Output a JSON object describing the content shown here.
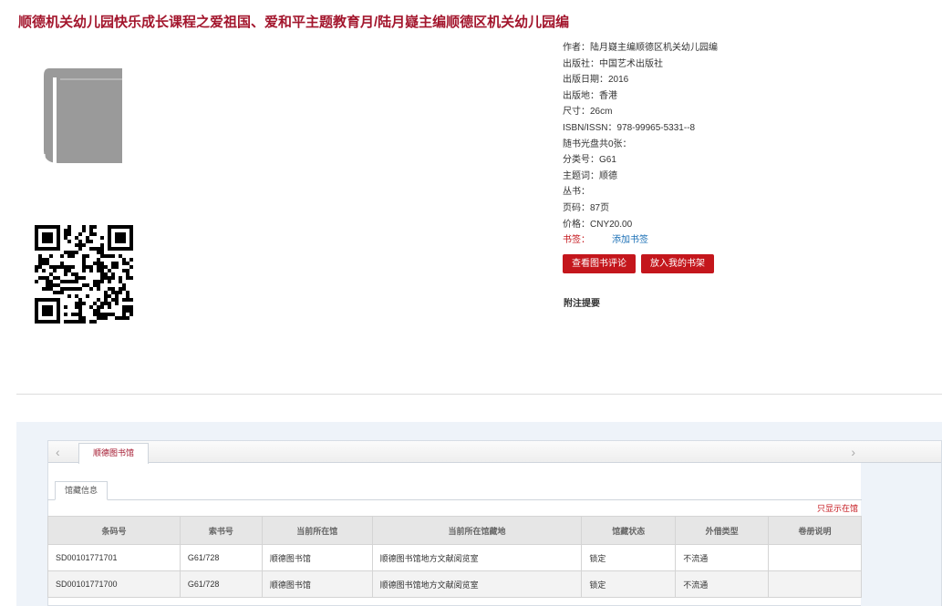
{
  "title": "顺德机关幼儿园快乐成长课程之爱祖国、爱和平主题教育月/陆月嶷主编顺德区机关幼儿园编",
  "book": {
    "meta": [
      {
        "label": "作者：",
        "value": "陆月嶷主编顺德区机关幼儿园编"
      },
      {
        "label": "出版社：",
        "value": "中国艺术出版社"
      },
      {
        "label": "出版日期：",
        "value": "2016"
      },
      {
        "label": "出版地：",
        "value": "香港"
      },
      {
        "label": "尺寸：",
        "value": "26cm"
      },
      {
        "label": "ISBN/ISSN：",
        "value": "978-99965-5331--8"
      },
      {
        "label": "随书光盘共0张：",
        "value": ""
      },
      {
        "label": "分类号：",
        "value": "G61"
      },
      {
        "label": "主题词：",
        "value": "顺德"
      },
      {
        "label": "丛书：",
        "value": ""
      },
      {
        "label": "页码：",
        "value": "87页"
      },
      {
        "label": "价格：",
        "value": "CNY20.00"
      }
    ],
    "bookmark_label": "书签：",
    "bookmark_link": "添加书签",
    "btn_review": "查看图书评论",
    "btn_shelf": "放入我的书架",
    "note_title": "附注提要"
  },
  "holdings": {
    "library_tab": "顺德图书馆",
    "sub_tab": "馆藏信息",
    "only_show": "只显示在馆",
    "columns": [
      "条码号",
      "索书号",
      "当前所在馆",
      "当前所在馆藏地",
      "馆藏状态",
      "外借类型",
      "卷册说明"
    ],
    "rows": [
      [
        "SD00101771701",
        "G61/728",
        "顺德图书馆",
        "顺德图书馆地方文献阅览室",
        "锁定",
        "不流通",
        ""
      ],
      [
        "SD00101771700",
        "G61/728",
        "顺德图书馆",
        "顺德图书馆地方文献阅览室",
        "锁定",
        "不流通",
        ""
      ]
    ]
  },
  "colors": {
    "accent": "#c4161c",
    "title": "#a3162d",
    "link": "#1a6fb5"
  },
  "icons": {
    "cover": "book-icon",
    "qr": "qr-code-icon",
    "prev": "chevron-left-icon",
    "next": "chevron-right-icon"
  }
}
